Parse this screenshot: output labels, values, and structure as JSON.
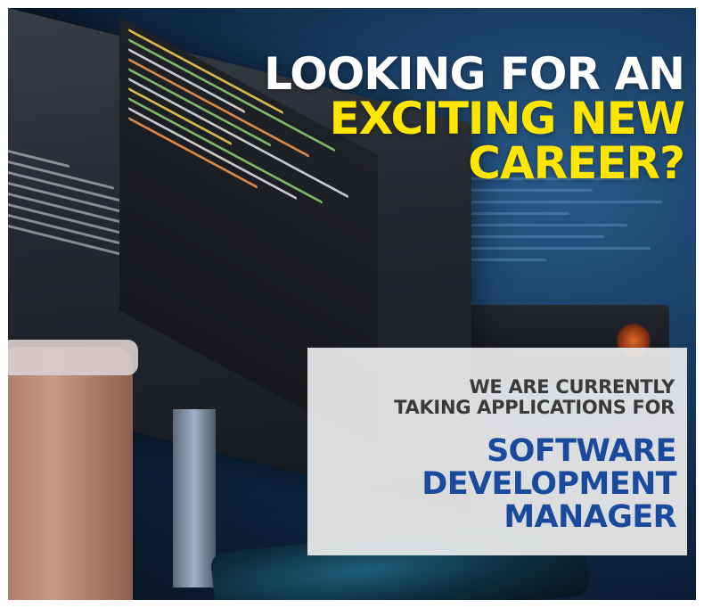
{
  "headline": {
    "line1": "LOOKING FOR AN",
    "line2": "EXCITING NEW",
    "line3": "CAREER?"
  },
  "card": {
    "sub_line1": "WE ARE CURRENTLY",
    "sub_line2": "TAKING APPLICATIONS FOR",
    "title_line1": "SOFTWARE",
    "title_line2": "DEVELOPMENT",
    "title_line3": "MANAGER"
  },
  "colors": {
    "headline_white": "#ffffff",
    "headline_yellow": "#ffe600",
    "title_blue": "#1a4a9e",
    "subtitle_gray": "#3a3a3a",
    "card_bg": "#ebebeb"
  }
}
